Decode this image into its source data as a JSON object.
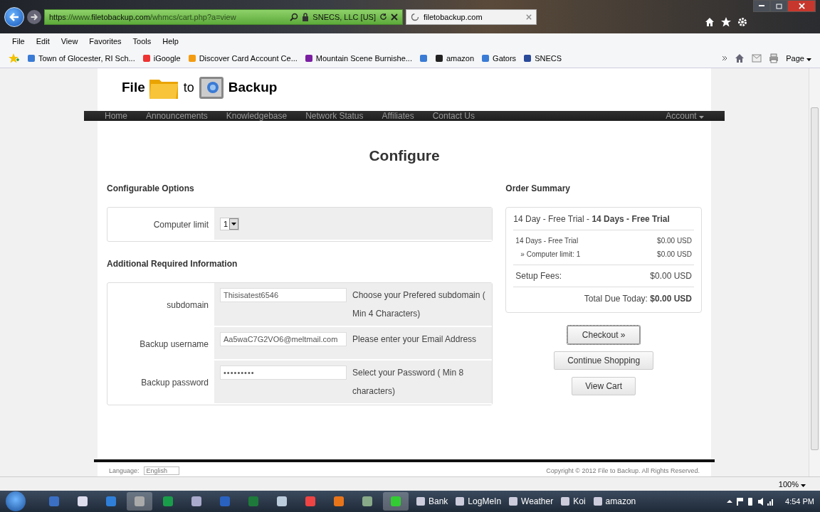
{
  "browser": {
    "url_scheme": "https",
    "url_faint_prefix": "://www.",
    "url_domain": "filetobackup.com",
    "url_faint_path": "/whmcs/cart.php?a=view",
    "site_identity": "SNECS, LLC [US]",
    "tab_title": "filetobackup.com",
    "menu": [
      "File",
      "Edit",
      "View",
      "Favorites",
      "Tools",
      "Help"
    ],
    "favorites": [
      {
        "label": "Town of Glocester, RI Sch...",
        "kind": "page"
      },
      {
        "label": "iGoogle",
        "kind": "google"
      },
      {
        "label": "Discover Card Account Ce...",
        "kind": "orange"
      },
      {
        "label": "Mountain Scene Burnishe...",
        "kind": "yahoo"
      },
      {
        "kind": "page"
      },
      {
        "label": "amazon",
        "kind": "amazon"
      },
      {
        "label": "Gators",
        "kind": "page"
      },
      {
        "label": "SNECS",
        "kind": "snecs"
      }
    ],
    "page_menu": "Page",
    "zoom": "100%"
  },
  "site": {
    "logo": [
      "File",
      "to",
      "Backup"
    ],
    "nav": [
      {
        "label": "Home"
      },
      {
        "label": "Announcements"
      },
      {
        "label": "Knowledgebase"
      },
      {
        "label": "Network Status"
      },
      {
        "label": "Affiliates"
      },
      {
        "label": "Contact Us"
      }
    ],
    "account": "Account",
    "title": "Configure",
    "options_heading": "Configurable Options",
    "options": [
      {
        "label": "Computer limit",
        "value": "1"
      }
    ],
    "info_heading": "Additional Required Information",
    "fields": [
      {
        "label": "subdomain",
        "value": "Thisisatest6546",
        "hint": "Choose your Prefered subdomain ( Min 4 Characters)",
        "kind": "text"
      },
      {
        "label": "Backup username",
        "value": "Aa5waC7G2VO6@meltmail.com",
        "hint": "Please enter your Email Address",
        "kind": "text"
      },
      {
        "label": "Backup password",
        "value": "•••••••••",
        "hint": "Select your Password ( Min 8 characters)",
        "kind": "password"
      }
    ],
    "summary_heading": "Order Summary",
    "summary": {
      "product": "14 Day - Free Trial - **14 Days - Free Trial**",
      "lines": [
        {
          "label": "14 Days - Free Trial",
          "amount": "$0.00 USD"
        },
        {
          "label": "» Computer limit: 1",
          "amount": "$0.00 USD"
        }
      ],
      "setup_label": "Setup Fees:",
      "setup_amount": "$0.00 USD",
      "total": "Total Due Today: **$0.00 USD**"
    },
    "buttons": [
      {
        "label": "Checkout »",
        "focused": true
      },
      {
        "label": "Continue Shopping",
        "focused": false
      },
      {
        "label": "View Cart",
        "focused": false
      }
    ],
    "footer": {
      "language_label": "Language:",
      "language": "English",
      "copyright": "Copyright © 2012 File to Backup. All Rights Reserved."
    }
  },
  "taskbar": {
    "apps": [
      {
        "label": "Bank"
      },
      {
        "label": "LogMeIn"
      },
      {
        "label": "Weather"
      },
      {
        "label": "Koi"
      },
      {
        "label": "amazon"
      }
    ],
    "time": "4:54 PM"
  }
}
